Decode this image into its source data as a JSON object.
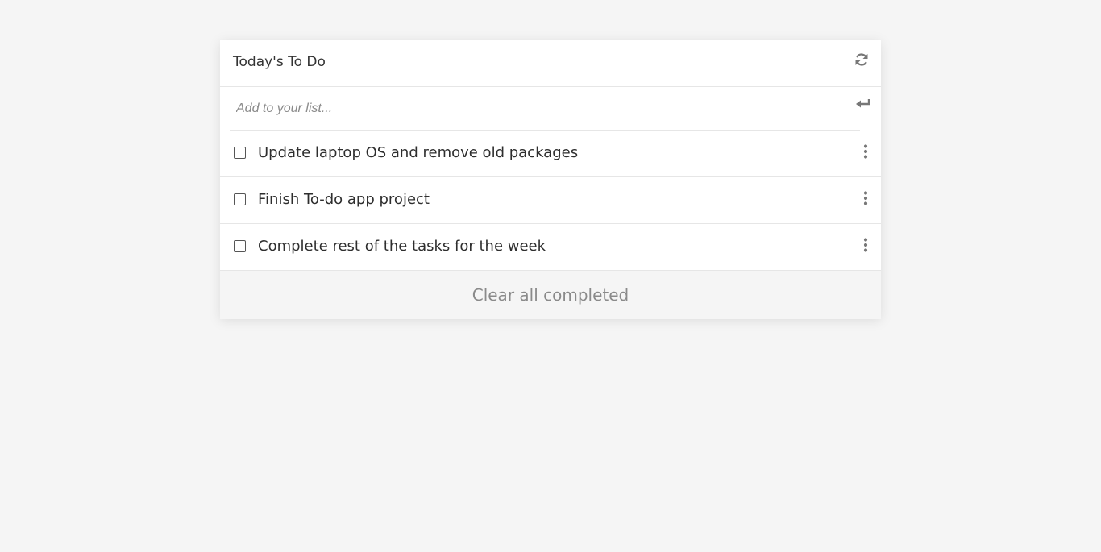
{
  "todo": {
    "title": "Today's To Do",
    "refresh_icon": "refresh-icon",
    "add_input": {
      "placeholder": "Add to your list...",
      "value": ""
    },
    "enter_icon": "enter-icon",
    "items": [
      {
        "text": "Update laptop OS and remove old packages",
        "checked": false
      },
      {
        "text": "Finish To-do app project",
        "checked": false
      },
      {
        "text": "Complete rest of the tasks for the week",
        "checked": false
      }
    ],
    "more_icon": "more-vertical-icon",
    "clear_label": "Clear all completed"
  },
  "colors": {
    "background": "#f5f5f5",
    "card": "#ffffff",
    "text": "#2e2e2e",
    "muted": "#8a8a8a",
    "icon": "#777777"
  }
}
